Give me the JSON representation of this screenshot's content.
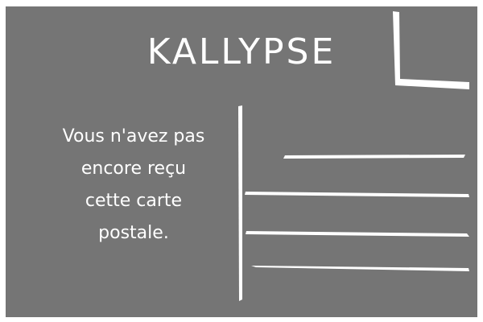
{
  "postcard": {
    "title": "KALLYPSE",
    "message": "Vous n'avez pas\nencore reçu\ncette carte\npostale.",
    "colors": {
      "card_background": "#757575",
      "ink": "#ffffff",
      "page_background": "#ffffff"
    },
    "icons": {
      "stamp": "stamp-box-corner",
      "divider": "vertical-divider",
      "address_lines": "address-line"
    }
  }
}
